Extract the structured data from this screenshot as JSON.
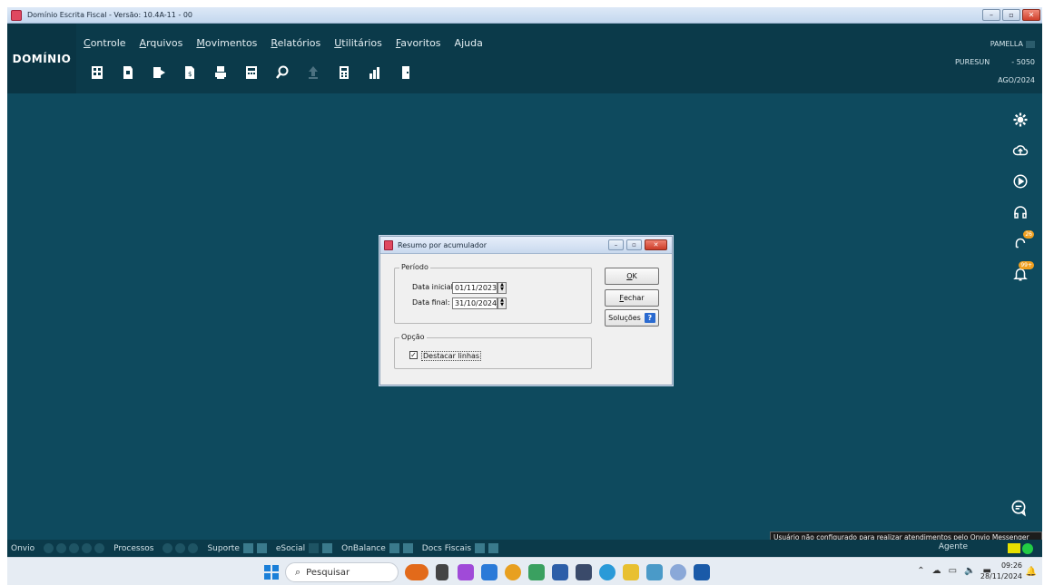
{
  "window": {
    "title": "Domínio Escrita Fiscal - Versão: 10.4A-11 - 00",
    "controls": [
      "–",
      "▫",
      "✕"
    ]
  },
  "app": {
    "logo": "DOMÍNIO",
    "menu": [
      {
        "accel": "C",
        "rest": "ontrole"
      },
      {
        "accel": "A",
        "rest": "rquivos"
      },
      {
        "accel": "M",
        "rest": "ovimentos"
      },
      {
        "accel": "R",
        "rest": "elatórios"
      },
      {
        "accel": "U",
        "rest": "tilitários"
      },
      {
        "accel": "F",
        "rest": "avoritos"
      },
      {
        "accel": "",
        "rest": "Ajuda"
      }
    ],
    "user": {
      "name": "PAMELLA",
      "company": "PURESUN",
      "code": "- 5050",
      "period": "AGO/2024"
    },
    "right_badges": {
      "support": "26",
      "notifications": "99+"
    }
  },
  "dialog": {
    "title": "Resumo por acumulador",
    "periodo_label": "Período",
    "data_inicial_label": "Data inicial:",
    "data_inicial_value": "01/11/2023",
    "data_final_label": "Data final:",
    "data_final_value": "31/10/2024",
    "opcao_label": "Opção",
    "destacar_label": "Destacar linhas",
    "destacar_checked": "✓",
    "ok_accel": "O",
    "ok_rest": "K",
    "fechar_accel": "F",
    "fechar_rest": "echar",
    "solucoes_label": "Soluções",
    "solucoes_badge": "?"
  },
  "statusbar": {
    "onvio": "Onvio",
    "processos": "Processos",
    "suporte": "Suporte",
    "esocial": "eSocial",
    "onbalance": "OnBalance",
    "docs_fiscais": "Docs Fiscais",
    "agente": "Agente",
    "tooltip": "Usuário não configurado para realizar atendimentos pelo Onvio Messenger"
  },
  "taskbar": {
    "search_placeholder": "Pesquisar",
    "time": "09:26",
    "date": "28/11/2024"
  }
}
